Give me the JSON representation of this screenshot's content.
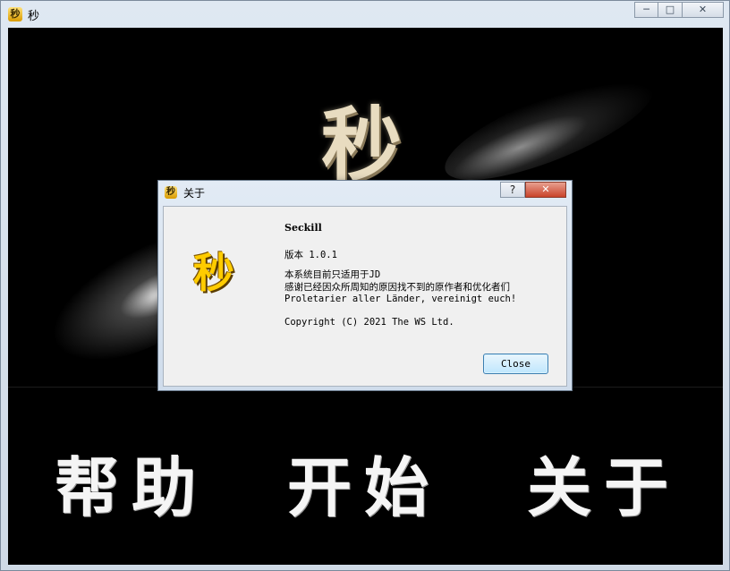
{
  "window": {
    "title": "秒",
    "icon_glyph": "秒",
    "controls": {
      "minimize": "─",
      "maximize": "□",
      "close": "✕"
    }
  },
  "client": {
    "logo_text": "秒",
    "buttons": {
      "help": "帮助",
      "start": "开始",
      "about": "关于"
    }
  },
  "dialog": {
    "title": "关于",
    "icon_glyph": "秒",
    "help_glyph": "?",
    "close_glyph": "✕",
    "logo_text": "秒",
    "app_name": "Seckill",
    "version": "版本 1.0.1",
    "description_lines": [
      "本系统目前只适用于JD",
      "感谢已经因众所周知的原因找不到的原作者和优化者们",
      "Proletarier aller Länder, vereinigt euch!"
    ],
    "copyright": "Copyright (C) 2021 The WS Ltd.",
    "close_label": "Close"
  },
  "colors": {
    "logo_gold": "#ffcc00",
    "client_background": "#000000",
    "dialog_background": "#f0f0f0"
  }
}
